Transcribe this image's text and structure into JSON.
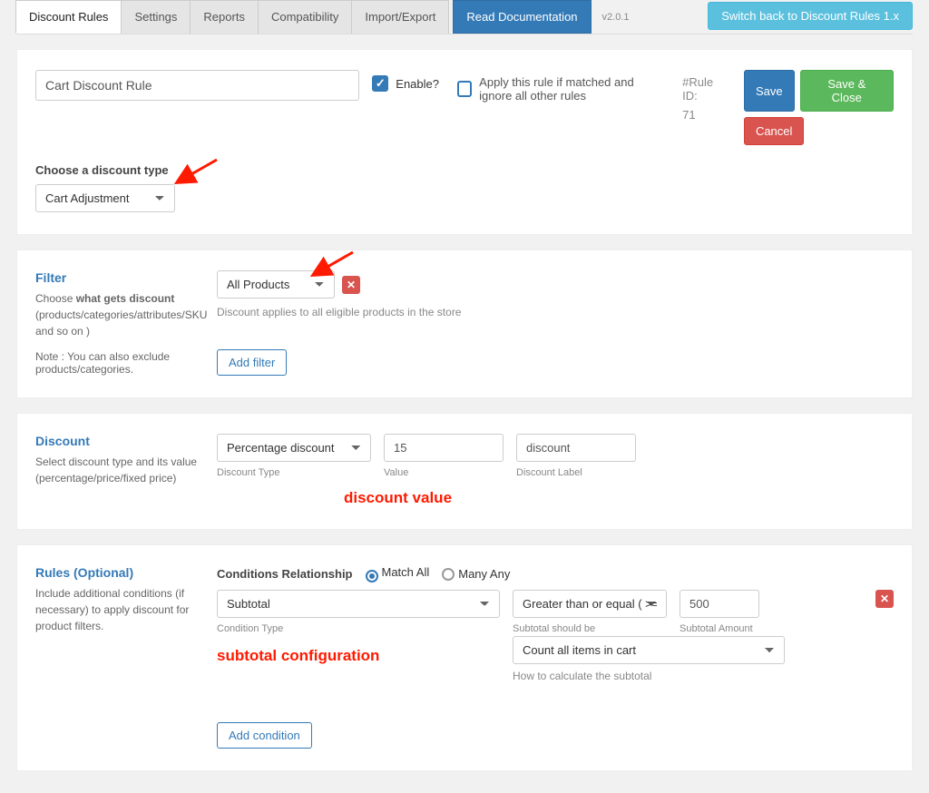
{
  "header": {
    "tabs": [
      "Discount Rules",
      "Settings",
      "Reports",
      "Compatibility",
      "Import/Export"
    ],
    "doc_btn": "Read Documentation",
    "version": "v2.0.1",
    "switch_btn": "Switch back to Discount Rules 1.x"
  },
  "top": {
    "title_value": "Cart Discount Rule",
    "enable_label": "Enable?",
    "apply_label": "Apply this rule if matched and ignore all other rules",
    "ruleid_label": "#Rule ID:",
    "ruleid_value": "71",
    "save": "Save",
    "save_close": "Save & Close",
    "cancel": "Cancel",
    "choose_label": "Choose a discount type",
    "discount_type": "Cart Adjustment"
  },
  "filter": {
    "title": "Filter",
    "desc1": "Choose ",
    "desc1b": "what gets discount",
    "desc2": " (products/categories/attributes/SKU and so on )",
    "note": "Note : You can also exclude products/categories.",
    "select_value": "All Products",
    "help": "Discount applies to all eligible products in the store",
    "add_btn": "Add filter"
  },
  "discount": {
    "title": "Discount",
    "desc": "Select discount type and its value (percentage/price/fixed price)",
    "type_value": "Percentage discount",
    "type_label": "Discount Type",
    "value_value": "15",
    "value_label": "Value",
    "label_value": "discount",
    "label_label": "Discount Label",
    "annot": "discount value"
  },
  "rules": {
    "title": "Rules (Optional)",
    "desc": "Include additional conditions (if necessary) to apply discount for product filters.",
    "cond_rel_label": "Conditions Relationship",
    "match_all": "Match All",
    "many_any": "Many Any",
    "cond_type": "Subtotal",
    "cond_type_label": "Condition Type",
    "operator": "Greater than or equal ( >= )",
    "operator_label": "Subtotal should be",
    "amount": "500",
    "amount_label": "Subtotal Amount",
    "calc_value": "Count all items in cart",
    "calc_label": "How to calculate the subtotal",
    "add_btn": "Add condition",
    "annot": "subtotal configuration"
  }
}
